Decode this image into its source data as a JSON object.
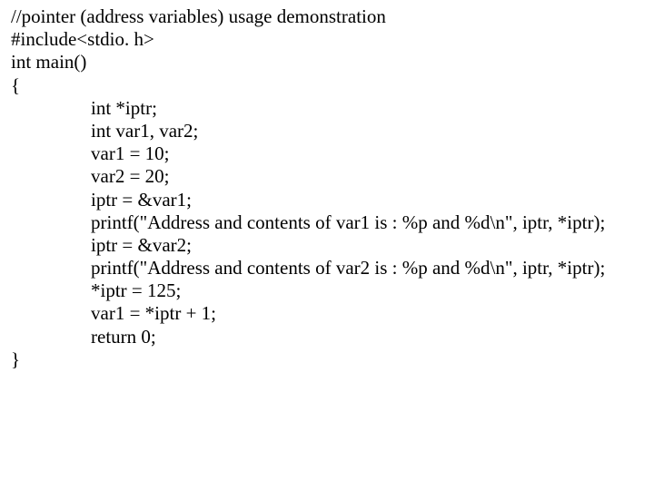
{
  "code": {
    "l1": "//pointer (address variables) usage demonstration",
    "l2": "#include<stdio. h>",
    "l3": "int main()",
    "l4": "{",
    "l5": "int *iptr;",
    "l6": "int var1, var2;",
    "l7": "var1 = 10;",
    "l8": "var2 = 20;",
    "l9": "iptr = &var1;",
    "l10": "printf(\"Address and contents of var1 is : %p and %d\\n\", iptr, *iptr);",
    "l11": "iptr = &var2;",
    "l12": "printf(\"Address and contents of var2 is : %p and %d\\n\", iptr, *iptr);",
    "l13": "*iptr = 125;",
    "l14": "var1 = *iptr + 1;",
    "l15": "return 0;",
    "l16": "}"
  }
}
